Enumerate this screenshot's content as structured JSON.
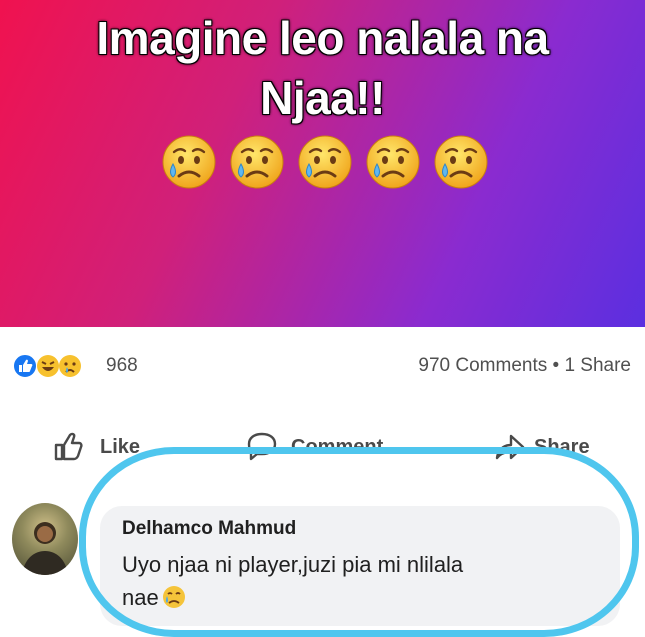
{
  "post": {
    "headline_line1": "Imagine leo nalala na",
    "headline_line2": "Njaa!!",
    "emoji_icons": [
      "sad-relieved-face-icon",
      "sad-relieved-face-icon",
      "sad-relieved-face-icon",
      "sad-relieved-face-icon",
      "sad-relieved-face-icon"
    ],
    "gradient_colors": [
      "#f0124f",
      "#8a2bd0",
      "#5b2fe0"
    ]
  },
  "stats": {
    "reaction_icons": [
      "like-icon",
      "haha-icon",
      "sad-icon"
    ],
    "reaction_count": "968",
    "comments_share": "970 Comments • 1 Share"
  },
  "actions": {
    "like_label": "Like",
    "comment_label": "Comment",
    "share_label": "Share"
  },
  "comment": {
    "author": "Delhamco Mahmud",
    "text_line1": "Uyo njaa ni player,juzi pia mi nlilala",
    "text_line2": "nae",
    "highlight_color": "#4fc6ee"
  }
}
